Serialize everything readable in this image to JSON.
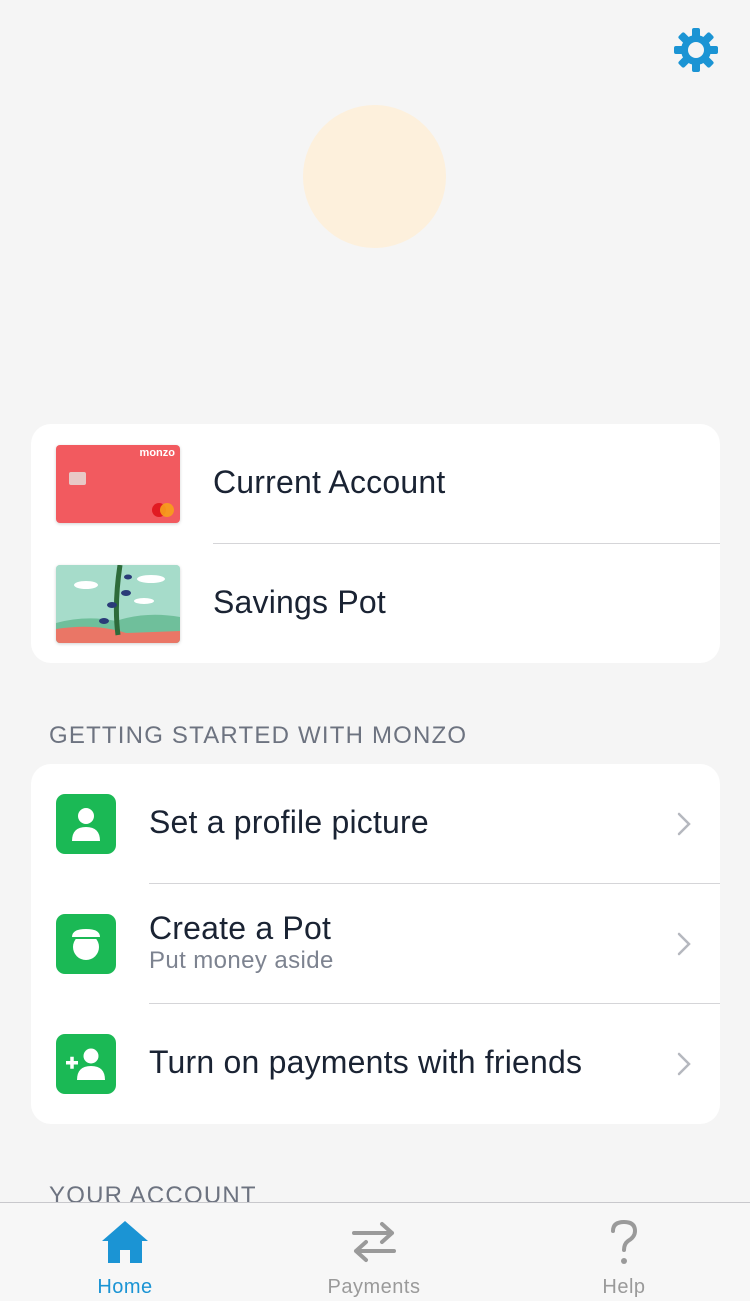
{
  "header": {
    "settings_icon": "gear-icon",
    "accent_color": "#1b94d4"
  },
  "accounts": [
    {
      "label": "Current Account",
      "card_brand": "monzo"
    },
    {
      "label": "Savings Pot"
    }
  ],
  "getting_started": {
    "title": "GETTING STARTED WITH MONZO",
    "items": [
      {
        "title": "Set a profile picture",
        "icon": "person-icon"
      },
      {
        "title": "Create a Pot",
        "subtitle": "Put money aside",
        "icon": "pot-icon"
      },
      {
        "title": "Turn on payments with friends",
        "icon": "add-friend-icon"
      }
    ]
  },
  "your_account": {
    "title": "YOUR ACCOUNT"
  },
  "tabbar": {
    "tabs": [
      {
        "label": "Home",
        "icon": "home-icon",
        "active": true
      },
      {
        "label": "Payments",
        "icon": "transfer-arrows-icon",
        "active": false
      },
      {
        "label": "Help",
        "icon": "question-icon",
        "active": false
      }
    ]
  },
  "colors": {
    "background": "#f5f5f5",
    "card": "#ffffff",
    "green": "#1bb955",
    "active_tab": "#1b94d4",
    "inactive_tab": "#9a9a9a",
    "current_card": "#f25a5f",
    "avatar": "#fdf0dc"
  }
}
